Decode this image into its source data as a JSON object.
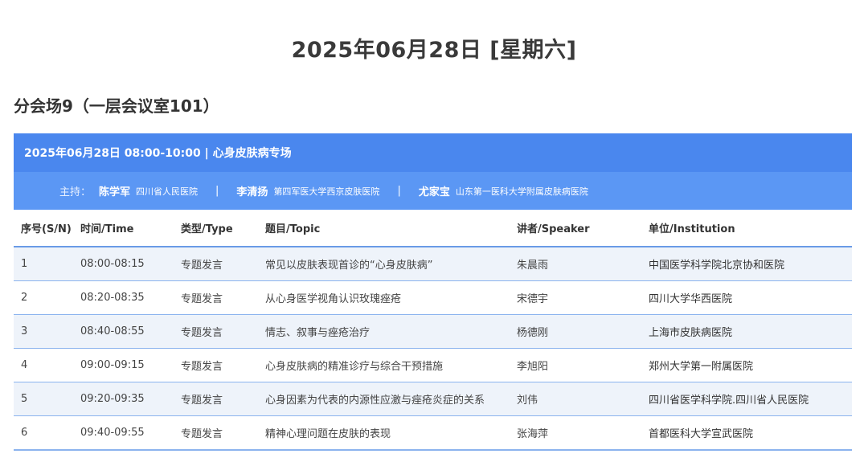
{
  "date_title": "2025年06月28日 [星期六]",
  "venue_title": "分会场9（一层会议室101）",
  "session": {
    "header": "2025年06月28日 08:00-10:00 | 心身皮肤病专场",
    "hosts_label": "主持：",
    "separator": "|",
    "hosts": [
      {
        "name": "陈学军",
        "institution": "四川省人民医院"
      },
      {
        "name": "李清扬",
        "institution": "第四军医大学西京皮肤医院"
      },
      {
        "name": "尤家宝",
        "institution": "山东第一医科大学附属皮肤病医院"
      }
    ]
  },
  "table": {
    "columns": [
      "序号(S/N)",
      "时间/Time",
      "类型/Type",
      "题目/Topic",
      "讲者/Speaker",
      "单位/Institution"
    ],
    "rows": [
      {
        "sn": "1",
        "time": "08:00-08:15",
        "type": "专题发言",
        "topic": "常见以皮肤表现首诊的“心身皮肤病”",
        "speaker": "朱晨雨",
        "institution": "中国医学科学院北京协和医院"
      },
      {
        "sn": "2",
        "time": "08:20-08:35",
        "type": "专题发言",
        "topic": "从心身医学视角认识玫瑰痤疮",
        "speaker": "宋德宇",
        "institution": "四川大学华西医院"
      },
      {
        "sn": "3",
        "time": "08:40-08:55",
        "type": "专题发言",
        "topic": "情志、叙事与痤疮治疗",
        "speaker": "杨德刚",
        "institution": "上海市皮肤病医院"
      },
      {
        "sn": "4",
        "time": "09:00-09:15",
        "type": "专题发言",
        "topic": "心身皮肤病的精准诊疗与综合干预措施",
        "speaker": "李旭阳",
        "institution": "郑州大学第一附属医院"
      },
      {
        "sn": "5",
        "time": "09:20-09:35",
        "type": "专题发言",
        "topic": "心身因素为代表的内源性应激与痤疮炎症的关系",
        "speaker": "刘伟",
        "institution": "四川省医学科学院.四川省人民医院"
      },
      {
        "sn": "6",
        "time": "09:40-09:55",
        "type": "专题发言",
        "topic": "精神心理问题在皮肤的表现",
        "speaker": "张海萍",
        "institution": "首都医科大学宣武医院"
      }
    ]
  },
  "colors": {
    "header_blue": "#4a87ee",
    "hosts_blue": "#5b97f4",
    "row_stripe": "#eef3fa",
    "row_border": "#8bb3ee"
  }
}
